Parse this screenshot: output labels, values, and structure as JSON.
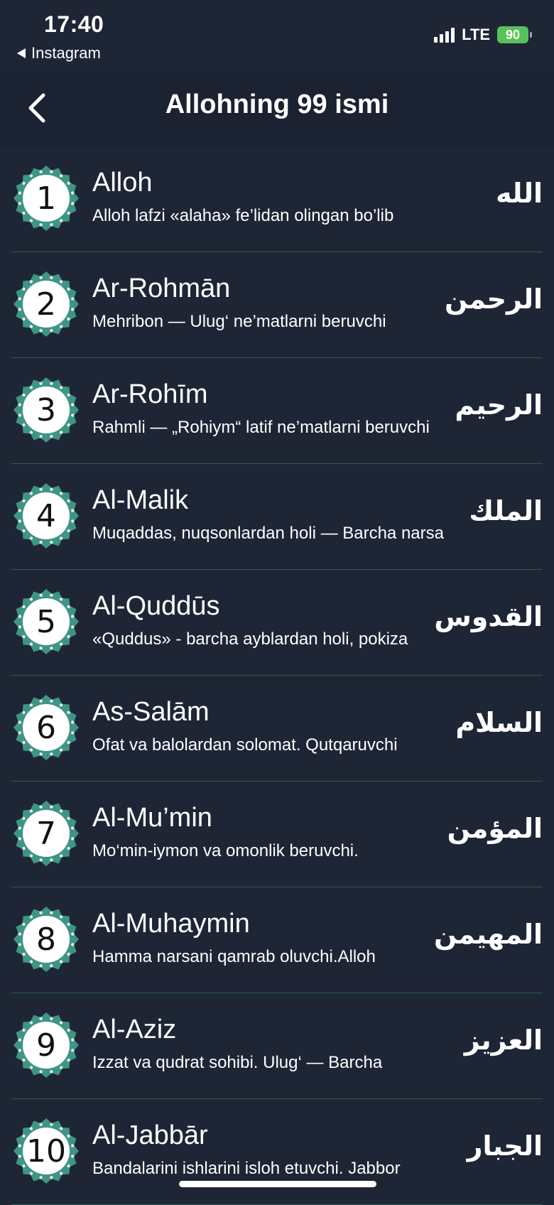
{
  "status_bar": {
    "time": "17:40",
    "back_app": "Instagram",
    "network": "LTE",
    "battery": "90"
  },
  "header": {
    "title": "Allohning 99 ismi"
  },
  "names": [
    {
      "number": "1",
      "name": "Alloh",
      "description": "Alloh lafzi «alaha» fe’lidan olingan bo’lib",
      "arabic": "الله"
    },
    {
      "number": "2",
      "name": "Ar-Rohmān",
      "description": "Mehribon — Ulug‘ ne’matlarni beruvchi",
      "arabic": "الرحمن"
    },
    {
      "number": "3",
      "name": "Ar-Rohīm",
      "description": "Rahmli — „Rohiym“ latif ne’matlarni beruvchi",
      "arabic": "الرحيم"
    },
    {
      "number": "4",
      "name": "Al-Malik",
      "description": "Muqaddas, nuqsonlardan holi — Barcha narsa",
      "arabic": "الملك"
    },
    {
      "number": "5",
      "name": "Al-Quddūs",
      "description": "«Quddus» - barcha ayblardan holi, pokiza",
      "arabic": "القدوس"
    },
    {
      "number": "6",
      "name": "As-Salām",
      "description": "Ofat va balolardan solomat. Qutqaruvchi",
      "arabic": "السلام"
    },
    {
      "number": "7",
      "name": "Al-Mu’min",
      "description": "Mo‘min-iymon va omonlik beruvchi.",
      "arabic": "المؤمن"
    },
    {
      "number": "8",
      "name": "Al-Muhaymin",
      "description": "Hamma narsani qamrab oluvchi.Alloh",
      "arabic": "المهيمن"
    },
    {
      "number": "9",
      "name": "Al-Aziz",
      "description": "Izzat va qudrat sohibi. Ulug‘ — Barcha",
      "arabic": "العزيز"
    },
    {
      "number": "10",
      "name": "Al-Jabbār",
      "description": "Bandalarini ishlarini isloh etuvchi. Jabbor",
      "arabic": "الجبار"
    }
  ],
  "colors": {
    "background": "#1e2636",
    "badge_ring": "#3f9585",
    "divider": "#2f5a57"
  }
}
